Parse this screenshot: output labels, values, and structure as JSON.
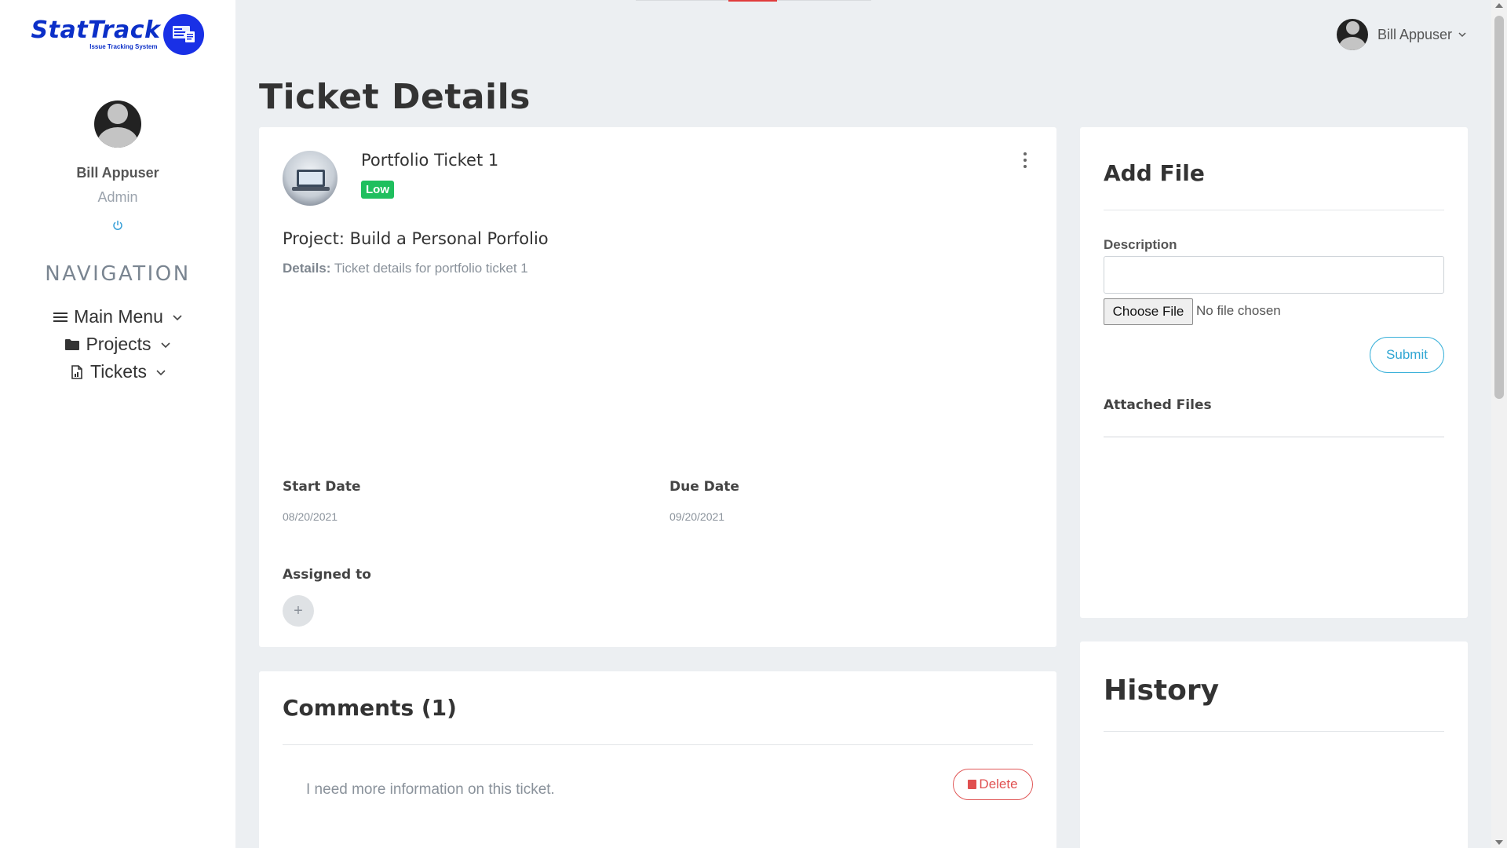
{
  "brand": {
    "name": "StatTrack",
    "tagline": "Issue Tracking System",
    "brand_color": "#0b2fc8"
  },
  "sidebar": {
    "user_name": "Bill Appuser",
    "user_role": "Admin",
    "power_icon": "power-icon",
    "nav_title": "NAVIGATION",
    "items": [
      {
        "label": "Main Menu",
        "icon": "menu-icon"
      },
      {
        "label": "Projects",
        "icon": "folder-icon"
      },
      {
        "label": "Tickets",
        "icon": "document-icon"
      }
    ]
  },
  "header": {
    "user_name": "Bill Appuser"
  },
  "page": {
    "title": "Ticket Details"
  },
  "ticket": {
    "name": "Portfolio Ticket 1",
    "priority": "Low",
    "priority_color": "#1fbf5e",
    "project": "Project: Build a Personal Porfolio",
    "details_label": "Details:",
    "details_text": "Ticket details for portfolio ticket 1",
    "start_date_label": "Start Date",
    "start_date": "08/20/2021",
    "due_date_label": "Due Date",
    "due_date": "09/20/2021",
    "assigned_label": "Assigned to",
    "assign_add": "+"
  },
  "add_file": {
    "title": "Add File",
    "description_label": "Description",
    "description_value": "",
    "choose_button": "Choose File",
    "no_file_text": "No file chosen",
    "submit_label": "Submit",
    "attached_title": "Attached Files"
  },
  "comments": {
    "title": "Comments (1)",
    "items": [
      {
        "text": "I need more information on this ticket.",
        "delete_label": "Delete"
      }
    ]
  },
  "history": {
    "title": "History"
  }
}
